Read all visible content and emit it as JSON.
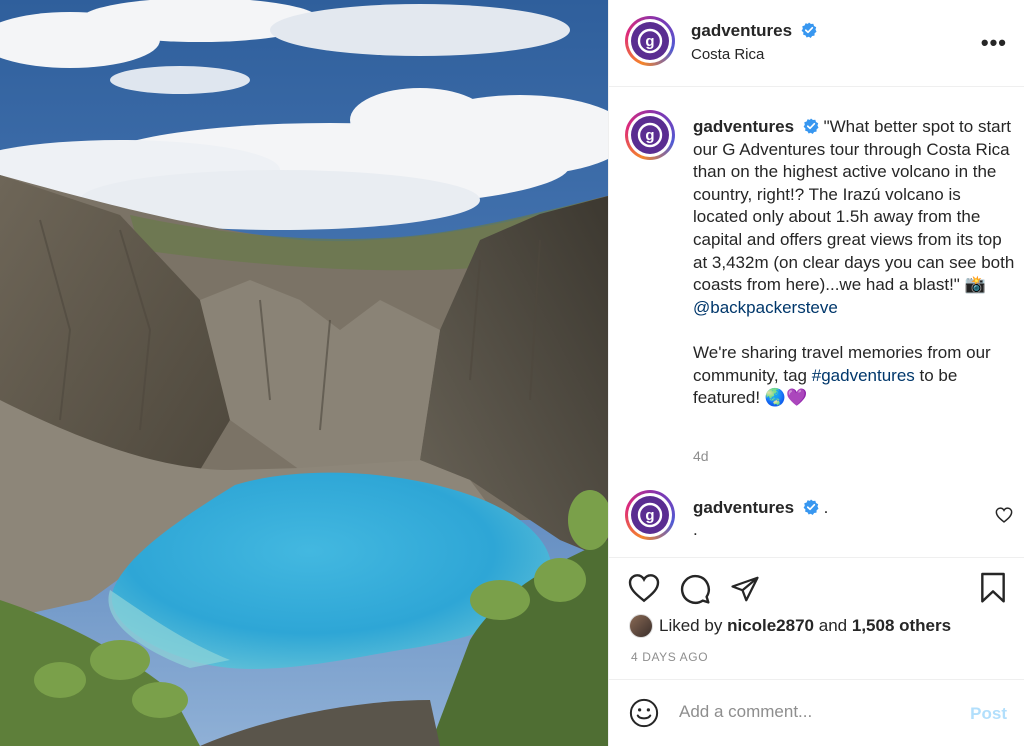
{
  "post": {
    "username": "gadventures",
    "location": "Costa Rica",
    "more_glyph": "•••"
  },
  "caption": {
    "text_before_mention": "\"What better spot to start our G Adventures tour through Costa Rica than on the highest active volcano in the country, right!? The Irazú volcano is located only about 1.5h away from the capital and offers great views from its top at 3,432m (on clear days you can see both coasts from here)...we had a blast!\" 📸",
    "mention": "@backpackersteve",
    "text_before_hashtag": "We're sharing travel memories from our community, tag",
    "hashtag": "#gadventures",
    "text_after_hashtag": "to be featured! 🌏💜",
    "age": "4d"
  },
  "comment": {
    "text1": ".",
    "text2": "."
  },
  "likes": {
    "prefix": "Liked by",
    "user": "nicole2870",
    "and": "and",
    "others": "1,508 others"
  },
  "timestamp": "4 DAYS AGO",
  "add_comment": {
    "placeholder": "Add a comment...",
    "post_label": "Post"
  },
  "colors": {
    "brand_purple": "#5a2d91",
    "verified_blue": "#3897f0",
    "link": "#00376b"
  }
}
